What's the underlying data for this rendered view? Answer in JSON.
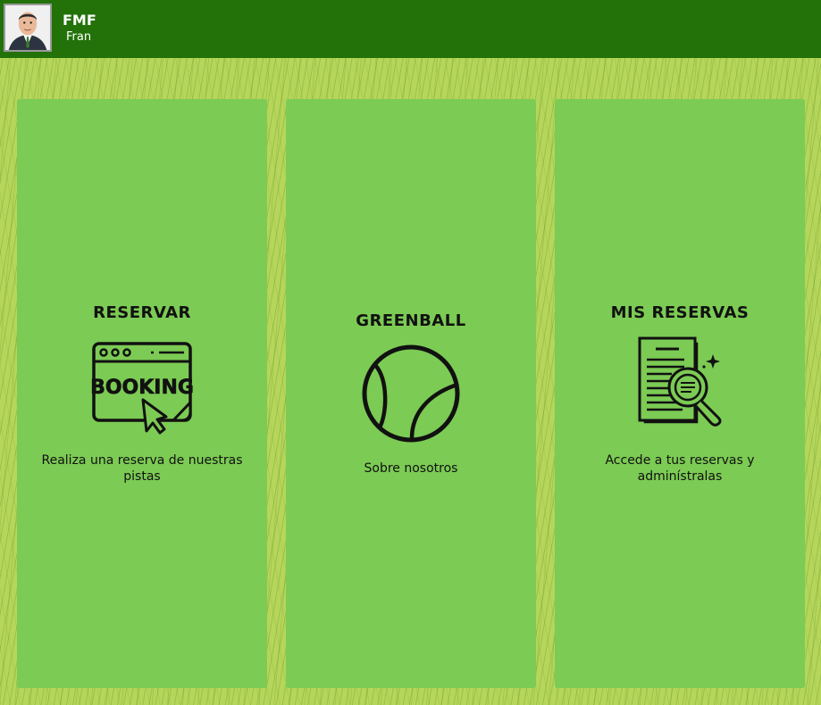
{
  "header": {
    "brand": "FMF",
    "username": "Fran"
  },
  "cards": [
    {
      "title": "RESERVAR",
      "description": "Realiza una reserva de nuestras pistas",
      "icon": "booking-icon",
      "icon_text": "BOOKING"
    },
    {
      "title": "GREENBALL",
      "description": "Sobre nosotros",
      "icon": "tennis-ball-icon"
    },
    {
      "title": "MIS RESERVAS",
      "description": "Accede a tus reservas y adminístralas",
      "icon": "document-search-icon"
    }
  ],
  "colors": {
    "header": "#227209",
    "card": "#7ccb54",
    "background": "#b5d65a"
  }
}
